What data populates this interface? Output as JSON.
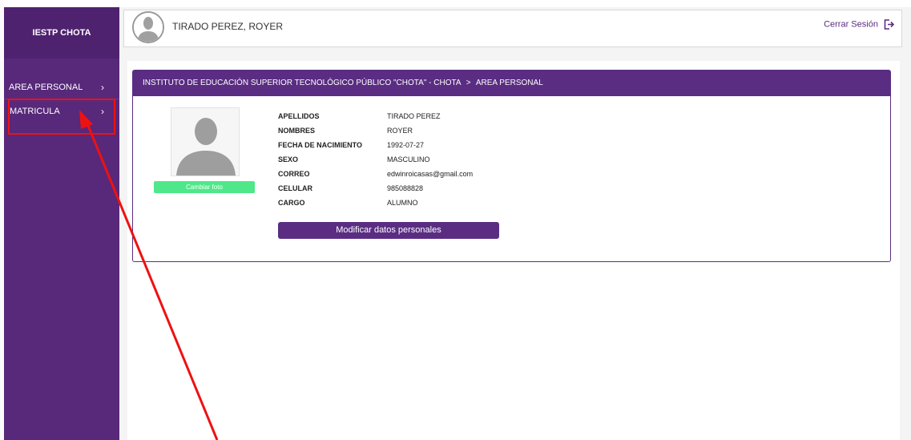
{
  "sidebar": {
    "brand": "IESTP CHOTA",
    "items": [
      {
        "label": "AREA PERSONAL",
        "chevron": "›"
      },
      {
        "label": "MATRICULA",
        "chevron": "›"
      }
    ]
  },
  "header": {
    "user_name": "TIRADO PEREZ, ROYER",
    "logout_label": "Cerrar Sesión",
    "logout_icon": "logout-icon"
  },
  "card": {
    "breadcrumb_institution": "INSTITUTO DE EDUCACIÓN SUPERIOR TECNOLÓGICO PÚBLICO \"CHOTA\" - CHOTA",
    "breadcrumb_separator": ">",
    "breadcrumb_section": "AREA PERSONAL",
    "change_photo_label": "Cambiar foto",
    "fields": [
      {
        "label": "APELLIDOS",
        "value": "TIRADO PEREZ"
      },
      {
        "label": "NOMBRES",
        "value": "ROYER"
      },
      {
        "label": "FECHA DE NACIMIENTO",
        "value": "1992-07-27"
      },
      {
        "label": "SEXO",
        "value": "MASCULINO"
      },
      {
        "label": "CORREO",
        "value": "edwinroicasas@gmail.com"
      },
      {
        "label": "CELULAR",
        "value": "985088828"
      },
      {
        "label": "CARGO",
        "value": "ALUMNO"
      }
    ],
    "modify_button_label": "Modificar datos personales"
  },
  "colors": {
    "sidebar": "#58287a",
    "accent": "#5a2d82",
    "photo_button": "#4ee88a",
    "annotation": "#ee1111"
  }
}
